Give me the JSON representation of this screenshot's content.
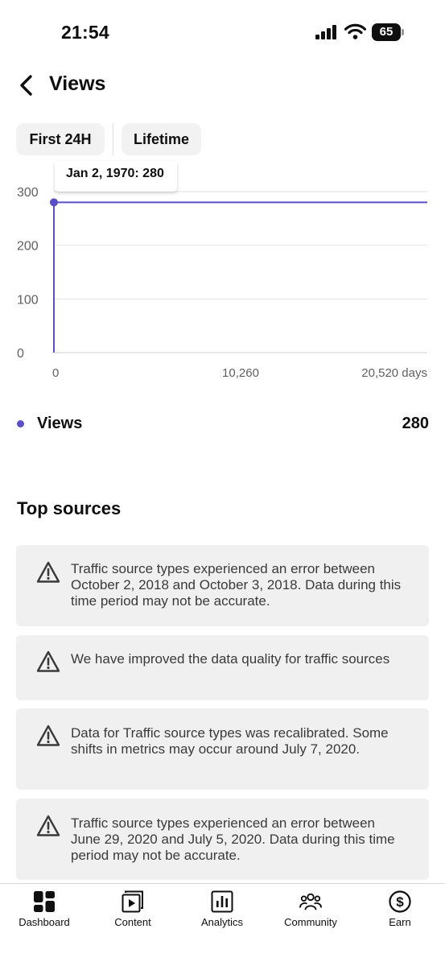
{
  "status_bar": {
    "time": "21:54",
    "battery": "65"
  },
  "header": {
    "title": "Views"
  },
  "filters": {
    "first_24h": "First 24H",
    "lifetime": "Lifetime"
  },
  "chart_data": {
    "type": "line",
    "x": [
      0,
      20520
    ],
    "y": [
      280,
      280
    ],
    "y_ticks": [
      "300",
      "200",
      "100",
      "0"
    ],
    "x_ticks": [
      "0",
      "10,260",
      "20,520 days"
    ],
    "ylim": [
      0,
      300
    ],
    "xlim": [
      0,
      20520
    ],
    "series": [
      {
        "name": "Views",
        "values": [
          280,
          280
        ]
      }
    ],
    "tooltip": "Jan 2, 1970: 280",
    "line_color": "#5b4fc7"
  },
  "legend": {
    "label": "Views",
    "value": "280",
    "color": "#5b4fc7"
  },
  "top_sources": {
    "title": "Top sources",
    "notices": [
      {
        "icon": "warning-icon",
        "text": "Traffic source types experienced an error between October 2, 2018 and October 3, 2018. Data during this time period may not be accurate."
      },
      {
        "icon": "warning-icon",
        "text": "We have improved the data quality for traffic sources"
      },
      {
        "icon": "warning-icon",
        "text": "Data for Traffic source types was recalibrated. Some shifts in metrics may occur around July 7, 2020."
      },
      {
        "icon": "warning-icon",
        "text": "Traffic source types experienced an error between June 29, 2020 and July 5, 2020. Data during this time period may not be accurate."
      }
    ]
  },
  "bottom_nav": {
    "items": [
      {
        "label": "Dashboard",
        "icon": "dashboard-icon"
      },
      {
        "label": "Content",
        "icon": "content-icon"
      },
      {
        "label": "Analytics",
        "icon": "analytics-icon"
      },
      {
        "label": "Community",
        "icon": "community-icon"
      },
      {
        "label": "Earn",
        "icon": "earn-icon"
      }
    ]
  }
}
